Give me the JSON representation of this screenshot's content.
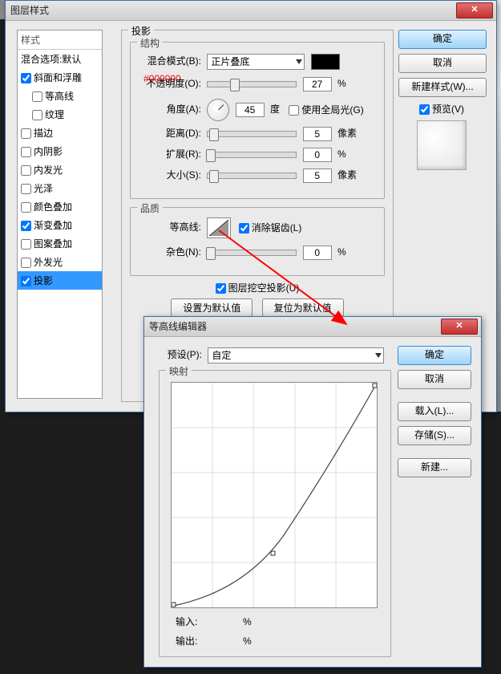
{
  "main": {
    "title": "图层样式",
    "styles_header": "样式",
    "blend_opts": "混合选项:默认",
    "items": [
      {
        "label": "斜面和浮雕",
        "checked": true
      },
      {
        "label": "等高线",
        "checked": false,
        "indent": true
      },
      {
        "label": "纹理",
        "checked": false,
        "indent": true
      },
      {
        "label": "描边",
        "checked": false
      },
      {
        "label": "内阴影",
        "checked": false
      },
      {
        "label": "内发光",
        "checked": false
      },
      {
        "label": "光泽",
        "checked": false
      },
      {
        "label": "颜色叠加",
        "checked": false
      },
      {
        "label": "渐变叠加",
        "checked": true
      },
      {
        "label": "图案叠加",
        "checked": false
      },
      {
        "label": "外发光",
        "checked": false
      },
      {
        "label": "投影",
        "checked": true,
        "selected": true
      }
    ],
    "panel_title": "投影",
    "struct_group": "结构",
    "quality_group": "品质",
    "blend_mode_label": "混合模式(B):",
    "blend_mode_value": "正片叠底",
    "color_hex": "#000000",
    "opacity_label": "不透明度(O):",
    "opacity_value": "27",
    "opacity_unit": "%",
    "angle_label": "角度(A):",
    "angle_value": "45",
    "angle_unit": "度",
    "global_light": "使用全局光(G)",
    "distance_label": "距离(D):",
    "distance_value": "5",
    "distance_unit": "像素",
    "spread_label": "扩展(R):",
    "spread_value": "0",
    "spread_unit": "%",
    "size_label": "大小(S):",
    "size_value": "5",
    "size_unit": "像素",
    "contour_label": "等高线:",
    "antialias": "消除锯齿(L)",
    "noise_label": "杂色(N):",
    "noise_value": "0",
    "noise_unit": "%",
    "knockout": "图层挖空投影(U)",
    "make_default": "设置为默认值",
    "reset_default": "复位为默认值",
    "buttons": {
      "ok": "确定",
      "cancel": "取消",
      "new_style": "新建样式(W)...",
      "preview": "预览(V)"
    }
  },
  "editor": {
    "title": "等高线编辑器",
    "preset_label": "预设(P):",
    "preset_value": "自定",
    "mapping": "映射",
    "input_label": "输入:",
    "output_label": "输出:",
    "unit": "%",
    "buttons": {
      "ok": "确定",
      "cancel": "取消",
      "load": "载入(L)...",
      "save": "存储(S)...",
      "new": "新建..."
    }
  }
}
